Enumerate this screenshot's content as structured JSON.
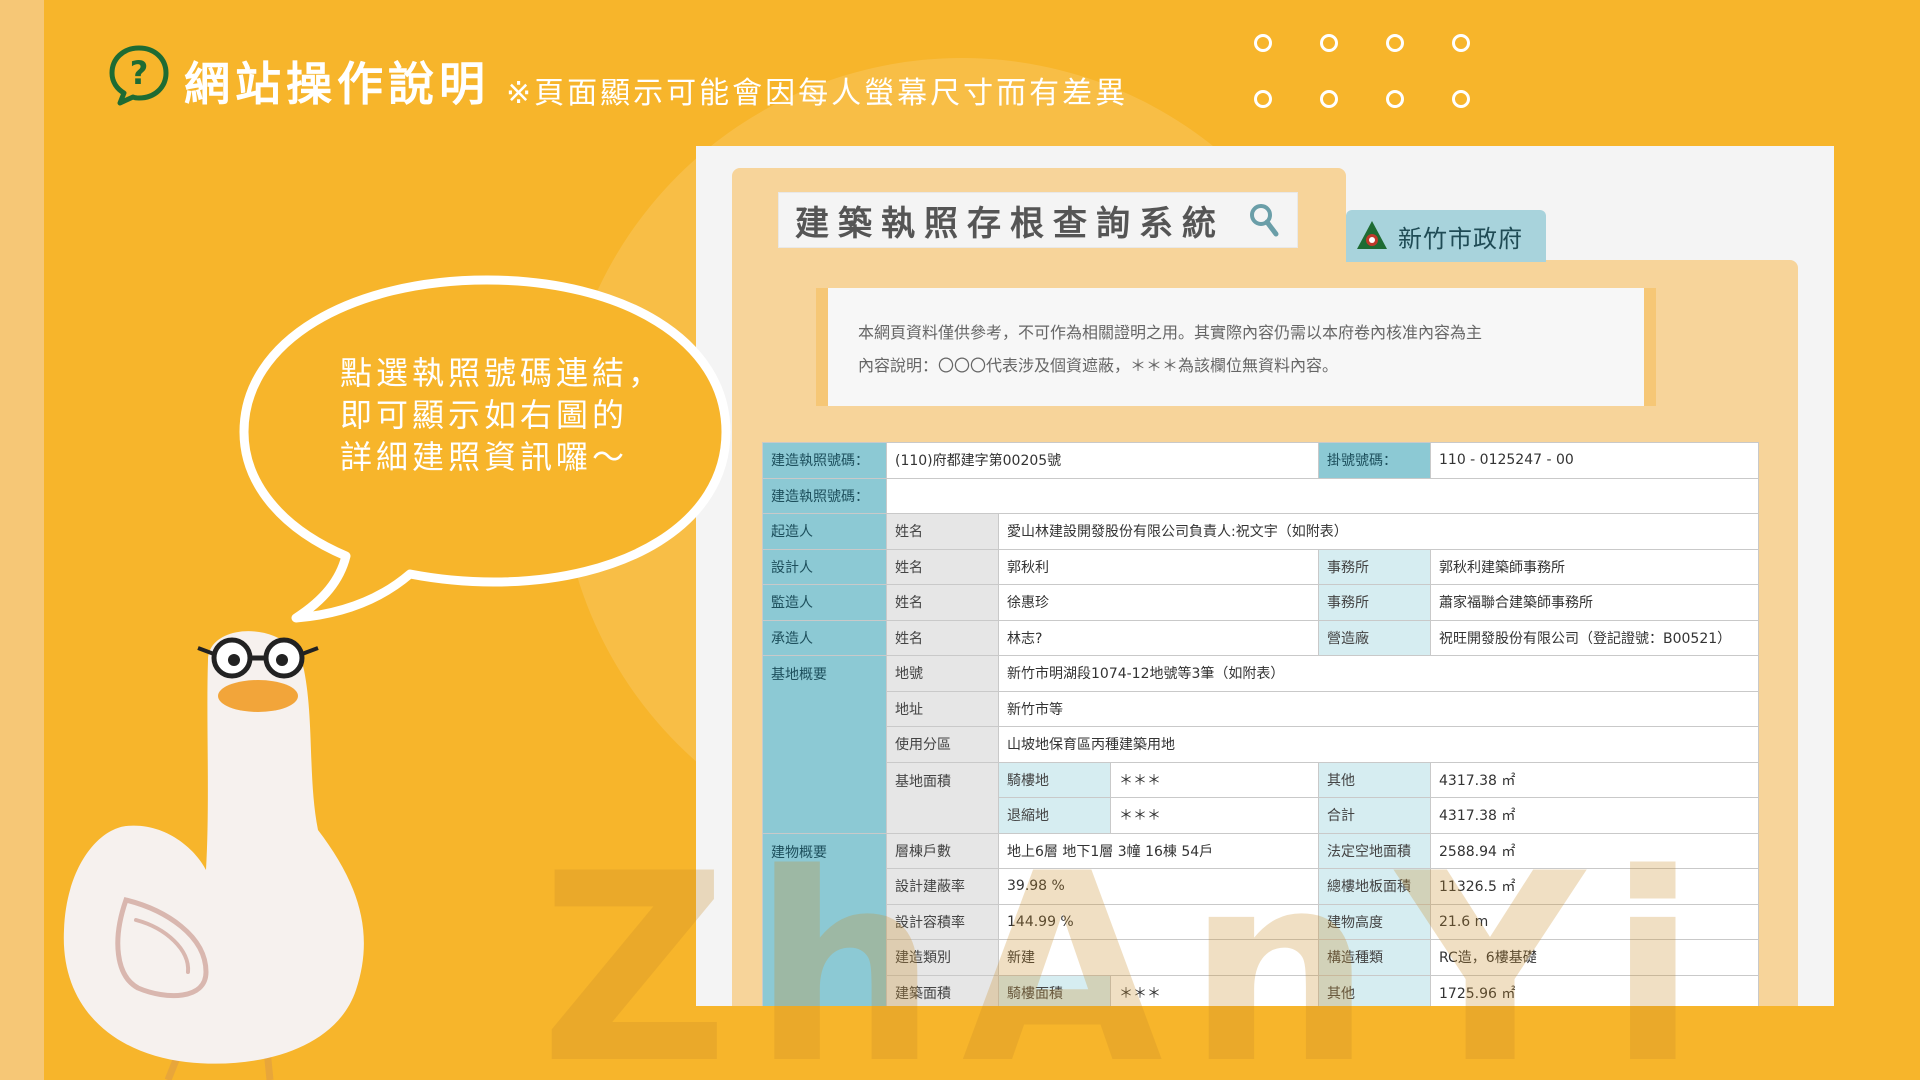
{
  "header": {
    "title": "網站操作說明",
    "note": "※頁面顯示可能會因每人螢幕尺寸而有差異"
  },
  "bubble": {
    "lines": [
      "點選執照號碼連結，",
      "即可顯示如右圖的",
      "詳細建照資訊囉～"
    ]
  },
  "watermark": {
    "text": "ZhAnYi"
  },
  "system": {
    "title": "建築執照存根查詢系統",
    "gov_name": "新竹市政府",
    "notice_lines": [
      "本網頁資料僅供參考，不可作為相關證明之用。其實際內容仍需以本府卷內核准內容為主",
      "內容說明：〇〇〇代表涉及個資遮蔽，＊＊＊為該欄位無資料內容。"
    ]
  },
  "table": {
    "row1": {
      "label": "建造執照號碼：",
      "value": "(110)府都建字第00205號",
      "label2": "掛號號碼：",
      "value2": "110 - 0125247 - 00"
    },
    "row2": {
      "label": "建造執照號碼：",
      "value": ""
    },
    "qizaoren": {
      "role": "起造人",
      "name_label": "姓名",
      "name": "愛山林建設開發股份有限公司負責人:祝文宇（如附表）"
    },
    "sheji": {
      "role": "設計人",
      "name_label": "姓名",
      "name": "郭秋利",
      "office_label": "事務所",
      "office": "郭秋利建築師事務所"
    },
    "jianzao": {
      "role": "監造人",
      "name_label": "姓名",
      "name": "徐惠珍",
      "office_label": "事務所",
      "office": "蕭家福聯合建築師事務所"
    },
    "chengzao": {
      "role": "承造人",
      "name_label": "姓名",
      "name": "林志?",
      "office_label": "營造廠",
      "office": "祝旺開發股份有限公司（登記證號：B00521）"
    },
    "site": {
      "section": "基地概要",
      "lot_label": "地號",
      "lot": "新竹市明湖段1074-12地號等3筆（如附表）",
      "addr_label": "地址",
      "addr": "新竹市等",
      "zone_label": "使用分區",
      "zone": "山坡地保育區丙種建築用地",
      "area_label": "基地面積",
      "arcade_label": "騎樓地",
      "arcade": "＊＊＊",
      "other_label": "其他",
      "other": "4317.38 ㎡",
      "setback_label": "退縮地",
      "setback": "＊＊＊",
      "total_label": "合計",
      "total": "4317.38 ㎡"
    },
    "building": {
      "section": "建物概要",
      "floors_label": "層棟戶數",
      "floors": "地上6層 地下1層 3幢 16棟 54戶",
      "open_label": "法定空地面積",
      "open": "2588.94 ㎡",
      "coverage_label": "設計建蔽率",
      "coverage": "39.98 %",
      "floor_area_label": "總樓地板面積",
      "floor_area": "11326.5 ㎡",
      "far_label": "設計容積率",
      "far": "144.99 %",
      "height_label": "建物高度",
      "height": "21.6 m",
      "type_label": "建造類別",
      "type": "新建",
      "struct_label": "構造種類",
      "struct": "RC造，6樓基礎",
      "barea_label": "建築面積",
      "arcade_area_label": "騎樓面積",
      "arcade_area": "＊＊＊",
      "other_label": "其他",
      "other": "1725.96 ㎡"
    }
  },
  "colors": {
    "background": "#F7B52B",
    "accent_green": "#1E6B33",
    "table_label": "#8CC9D4",
    "tab_bg": "#A8D3DC"
  }
}
